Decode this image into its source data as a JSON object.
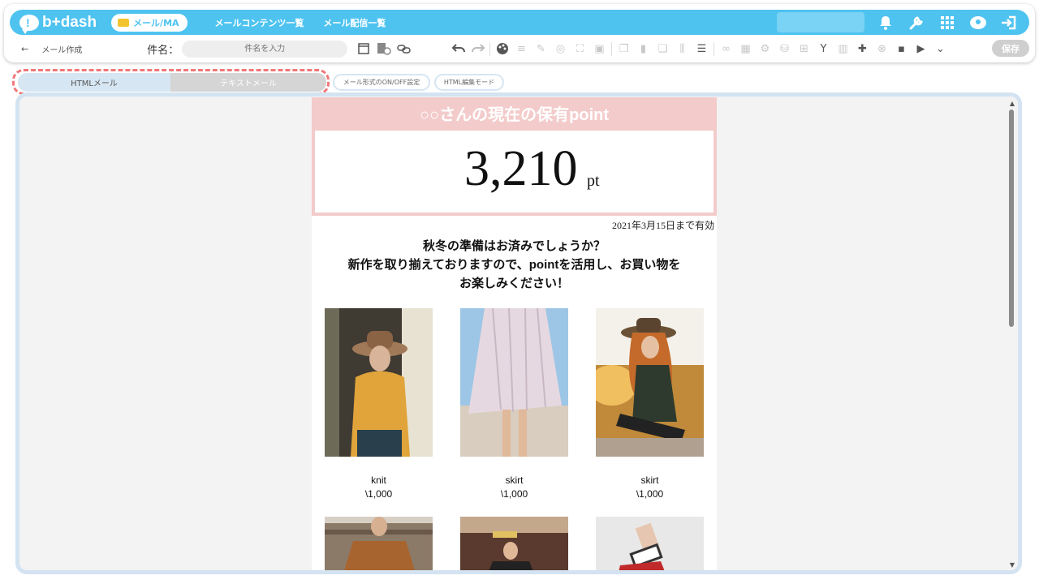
{
  "header": {
    "logo_text": "b+dash",
    "nav_pill_label": "メール/MA",
    "nav_links": [
      "メールコンテンツ一覧",
      "メール配信一覧"
    ],
    "icons": [
      "bell-icon",
      "wrench-icon",
      "grid-icon",
      "user-icon",
      "logout-icon"
    ]
  },
  "toolbar": {
    "back_symbol": "←",
    "breadcrumb": "メール作成",
    "subject_label": "件名：",
    "subject_placeholder": "件名を入力",
    "save_label": "保存"
  },
  "tabs": {
    "html_label": "HTMLメール",
    "text_label": "テキストメール",
    "format_toggle_label": "メール形式のON/OFF設定",
    "html_mode_label": "HTML編集モード"
  },
  "email": {
    "points_title": "○○さんの現在の保有point",
    "points_value": "3,210",
    "points_unit": "pt",
    "expiry": "2021年3月15日まで有効",
    "message_lines": [
      "秋冬の準備はお済みでしょうか？",
      "新作を取り揃えておりますので、pointを活用し、お買い物を",
      "お楽しみください！"
    ],
    "products": [
      {
        "name": "knit",
        "price": "\\1,000"
      },
      {
        "name": "skirt",
        "price": "\\1,000"
      },
      {
        "name": "skirt",
        "price": "\\1,000"
      }
    ]
  },
  "colors": {
    "accent": "#4ec3f0",
    "points_bg": "#f3cbcb",
    "highlight_dash": "#f0787b"
  }
}
